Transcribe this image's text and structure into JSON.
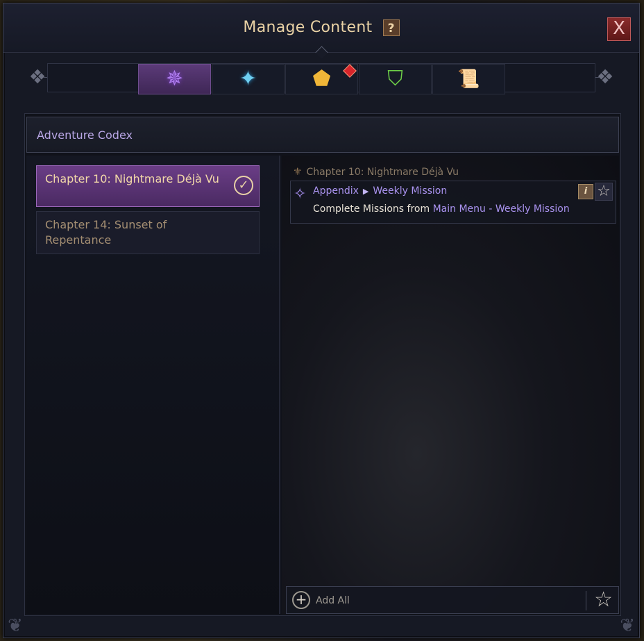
{
  "window": {
    "title": "Manage Content",
    "help_label": "?",
    "close_label": "X"
  },
  "tabs": [
    {
      "icon": "purple-compass-star-icon",
      "glyph": "✵",
      "active": true
    },
    {
      "icon": "blue-compass-star-icon",
      "glyph": "✦",
      "active": false
    },
    {
      "icon": "gold-pentagon-icon",
      "glyph": "⬟",
      "active": false,
      "notify": true
    },
    {
      "icon": "green-shield-icon",
      "glyph": "⛉",
      "active": false
    },
    {
      "icon": "scroll-icon",
      "glyph": "📜",
      "active": false
    }
  ],
  "section": {
    "title": "Adventure Codex"
  },
  "chapters": [
    {
      "label": "Chapter 10: Nightmare Déjà Vu",
      "selected": true,
      "check": "✓"
    },
    {
      "label": "Chapter 14: Sunset of Repentance",
      "selected": false
    }
  ],
  "quest_group": {
    "title": "Chapter 10: Nightmare Déjà Vu",
    "quest": {
      "category": "Appendix",
      "arrow": "▶",
      "name": "Weekly Mission",
      "desc_prefix": "Complete Missions from ",
      "desc_link": "Main Menu - Weekly Mission",
      "info_label": "i",
      "star_glyph": "☆"
    }
  },
  "footer": {
    "add_all_label": "Add All",
    "add_glyph": "+",
    "star_glyph": "☆"
  },
  "colors": {
    "title": "#e9d2a5",
    "accent_purple": "#a992ee",
    "selected_bg": "#5b3a78"
  }
}
